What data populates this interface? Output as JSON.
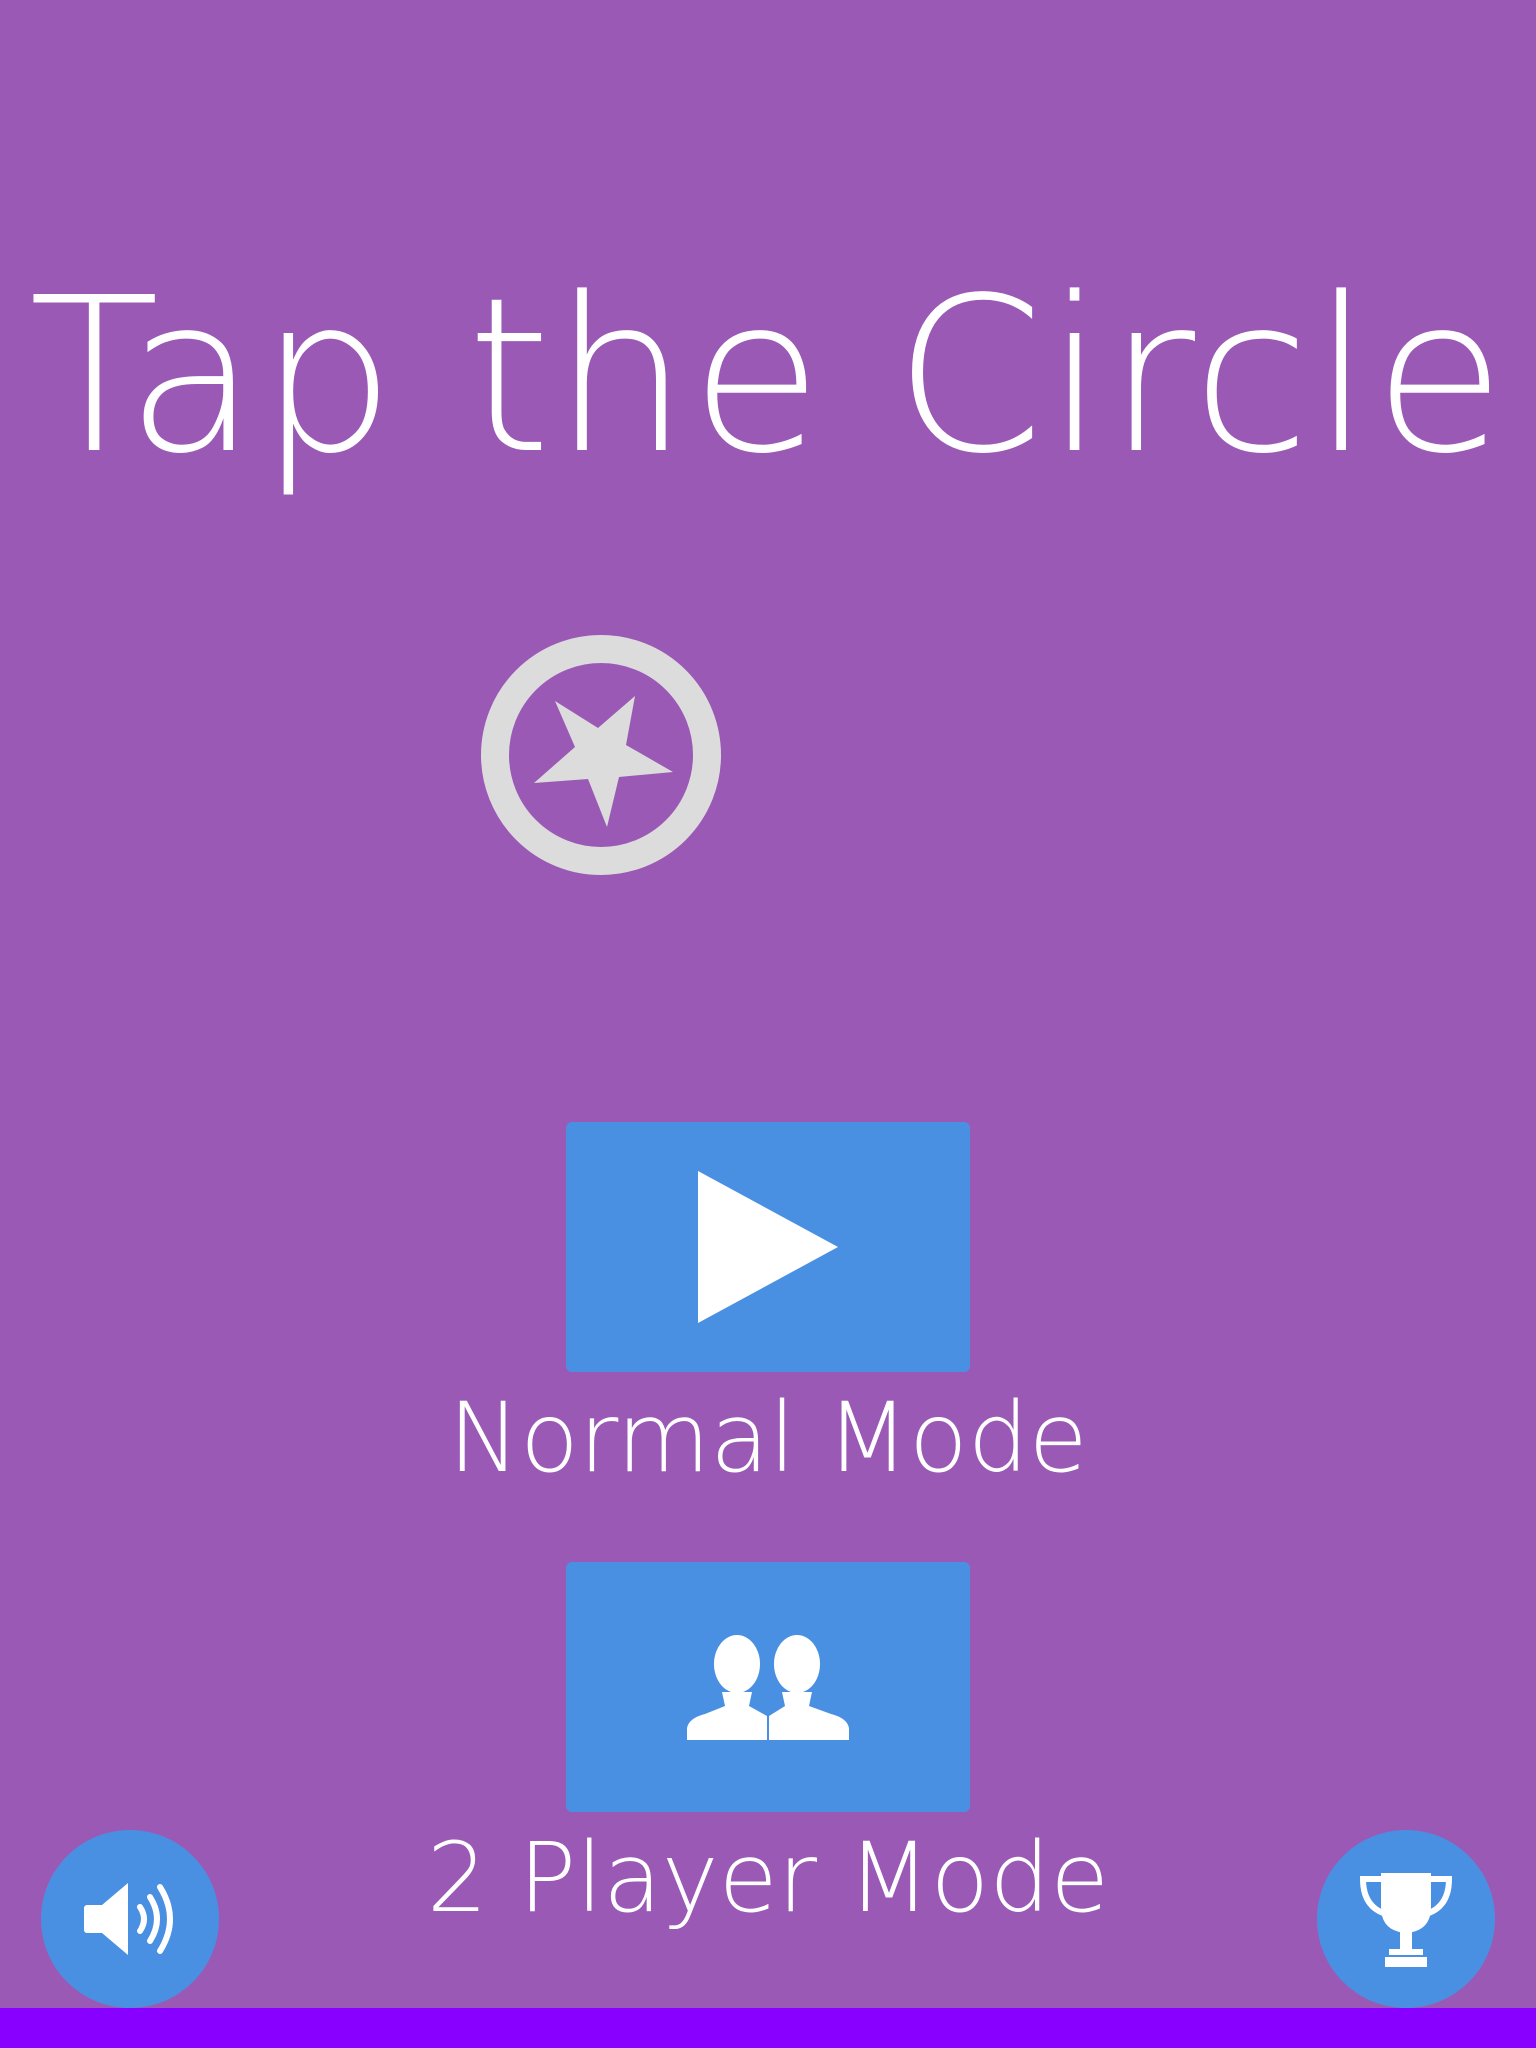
{
  "app": {
    "title": "Tap the Circle"
  },
  "logo": {
    "icon": "star-in-circle-icon"
  },
  "menu": {
    "normal_mode": {
      "label": "Normal Mode",
      "icon": "play-icon"
    },
    "two_player_mode": {
      "label": "2 Player Mode",
      "icon": "two-players-icon"
    }
  },
  "footer": {
    "sound_icon": "speaker-volume-icon",
    "leaderboard_icon": "trophy-icon"
  },
  "colors": {
    "background": "#9b59b6",
    "button": "#4a90e2",
    "text": "#ffffff",
    "logo": "#dcdcdc",
    "bottom_bar": "#8800ff"
  }
}
